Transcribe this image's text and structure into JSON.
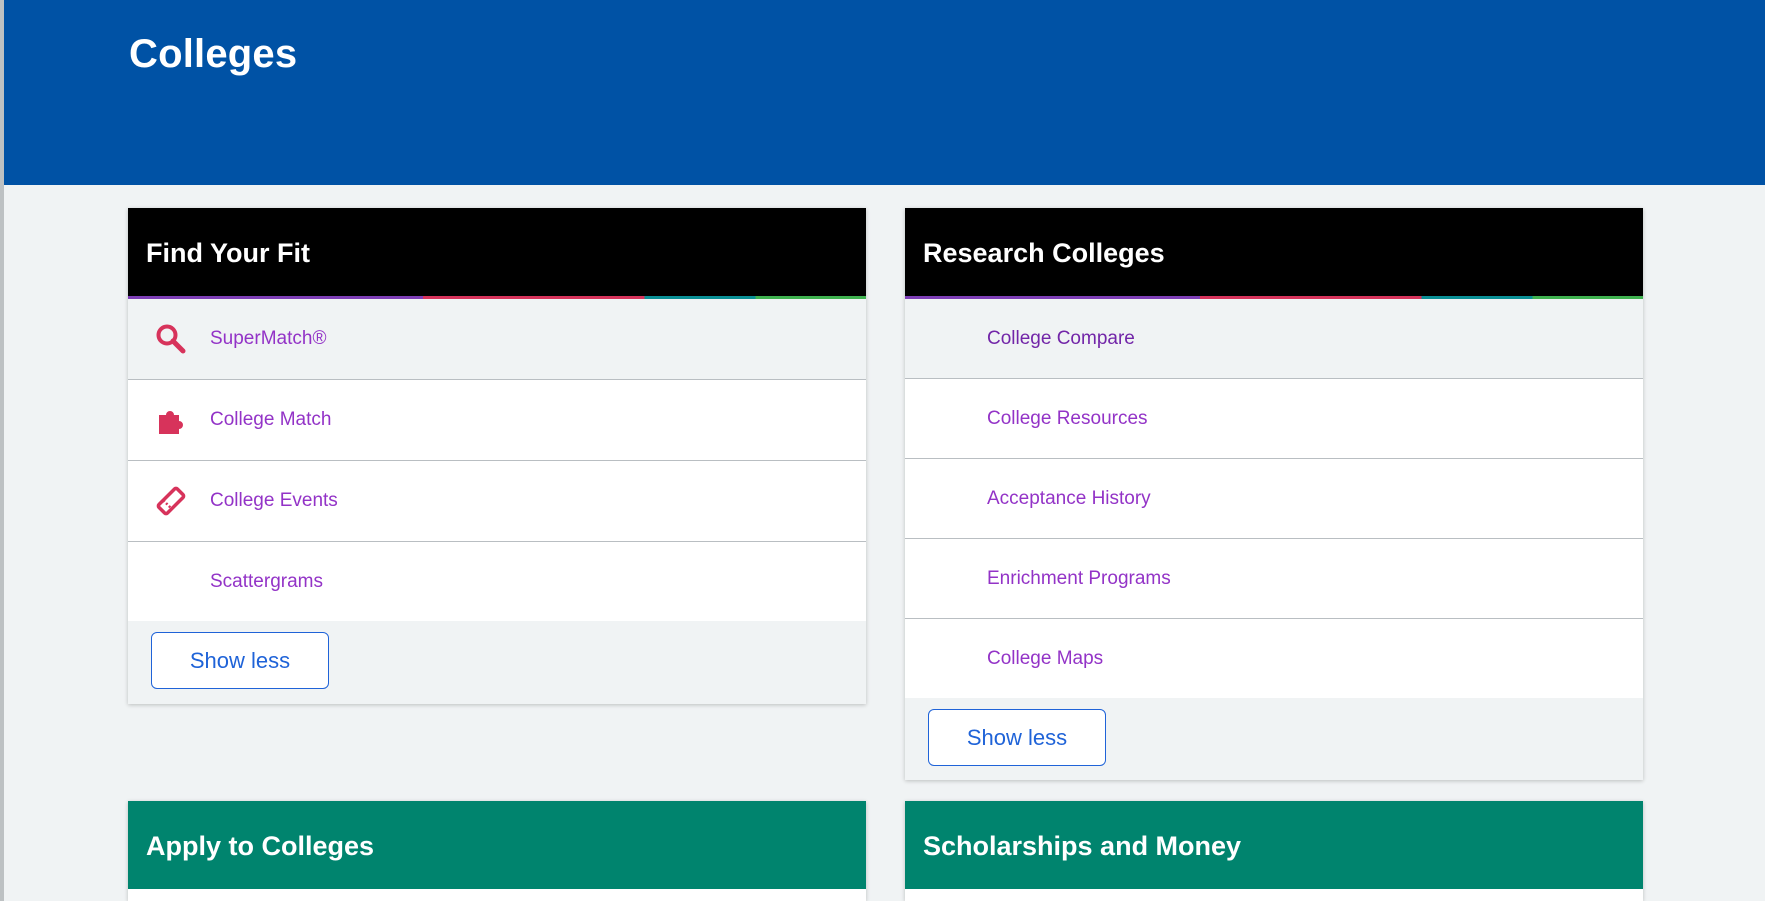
{
  "page": {
    "title": "Colleges"
  },
  "cards": {
    "find_your_fit": {
      "title": "Find Your Fit",
      "items": [
        {
          "label": "SuperMatch®",
          "icon": "magnifier-icon"
        },
        {
          "label": "College Match",
          "icon": "puzzle-piece-icon"
        },
        {
          "label": "College Events",
          "icon": "ticket-icon"
        },
        {
          "label": "Scattergrams"
        }
      ],
      "button": "Show less"
    },
    "research_colleges": {
      "title": "Research Colleges",
      "items": [
        {
          "label": "College Compare"
        },
        {
          "label": "College Resources"
        },
        {
          "label": "Acceptance History"
        },
        {
          "label": "Enrichment Programs"
        },
        {
          "label": "College Maps"
        }
      ],
      "button": "Show less"
    },
    "apply_to_colleges": {
      "title": "Apply to Colleges"
    },
    "scholarships_and_money": {
      "title": "Scholarships and Money"
    }
  },
  "colors": {
    "header": "#0052a5",
    "link": "#9333c7",
    "icon": "#d7335b",
    "button": "#1f63d8",
    "green_header": "#00846e"
  }
}
